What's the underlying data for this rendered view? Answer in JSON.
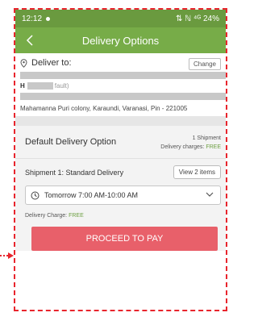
{
  "status_bar": {
    "time": "12:12",
    "indicators": "⇅ ℕ ⁴ᴳ 24%"
  },
  "app_bar": {
    "title": "Delivery Options",
    "back_icon": "chevron-left-icon"
  },
  "deliver": {
    "label": "Deliver to:",
    "change_label": "Change",
    "name_initial": "H",
    "default_tag": "fault)",
    "address": "Mahamanna Puri colony, Karaundi, Varanasi, Pin - 221005"
  },
  "delivery_option": {
    "title": "Default Delivery Option",
    "shipment_count": "1 Shipment",
    "charges_label": "Delivery charges: ",
    "charges_value": "FREE"
  },
  "shipment": {
    "label": "Shipment 1: Standard Delivery",
    "view_items_label": "View 2 items",
    "slot_value": "Tomorrow  7:00 AM-10:00 AM",
    "charge_label": "Delivery Charge: ",
    "charge_value": "FREE"
  },
  "proceed_label": "PROCEED TO PAY",
  "colors": {
    "status_green": "#6a9a3f",
    "header_green": "#77ac48",
    "free_green": "#6ea043",
    "pay_button": "#e8606a",
    "annotation_red": "#e8252d"
  }
}
